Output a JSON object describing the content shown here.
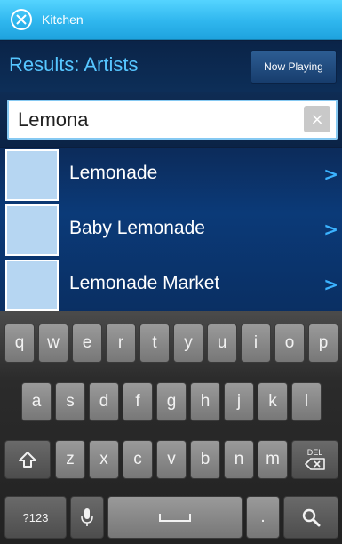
{
  "titlebar": {
    "title": "Kitchen"
  },
  "header": {
    "results_label": "Results: Artists",
    "now_playing_label": "Now Playing"
  },
  "search": {
    "value": "Lemona",
    "clear_glyph": "×"
  },
  "results": [
    {
      "name": "Lemonade"
    },
    {
      "name": "Baby Lemonade"
    },
    {
      "name": "Lemonade Market"
    }
  ],
  "chevron_glyph": ">",
  "keyboard": {
    "row1": [
      "q",
      "w",
      "e",
      "r",
      "t",
      "y",
      "u",
      "i",
      "o",
      "p"
    ],
    "row2": [
      "a",
      "s",
      "d",
      "f",
      "g",
      "h",
      "j",
      "k",
      "l"
    ],
    "row3": [
      "z",
      "x",
      "c",
      "v",
      "b",
      "n",
      "m"
    ],
    "symbols_label": "?123",
    "period_label": ".",
    "del_label": "DEL"
  },
  "colors": {
    "accent": "#56c6ff",
    "titlebar": "#2fb6ee",
    "background": "#0b1e3c"
  }
}
